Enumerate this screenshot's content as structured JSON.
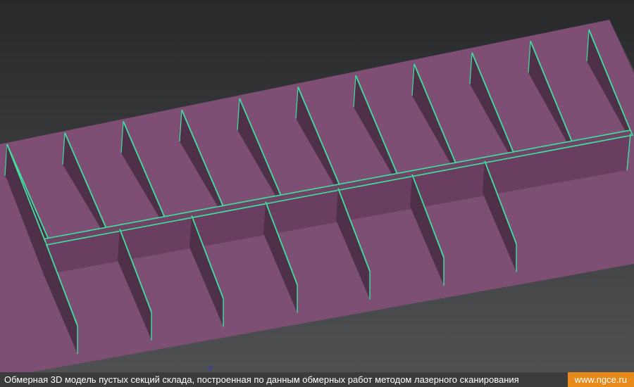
{
  "scene": {
    "description_colors": {
      "background_top": "#2a2c2e",
      "background_bottom": "#4a4c4e",
      "floor": "#7e4f74",
      "wall_face": "#4e3148",
      "wall_face_light": "#6a3e60",
      "wall_top": "#6e4565",
      "edge": "#3fe0a0"
    },
    "axis_indicator": "z"
  },
  "caption": {
    "text": "Обмерная 3D модель пустых секций склада, построенная по данным обмерных работ методом лазерного сканирования",
    "site": "www.ngce.ru"
  }
}
